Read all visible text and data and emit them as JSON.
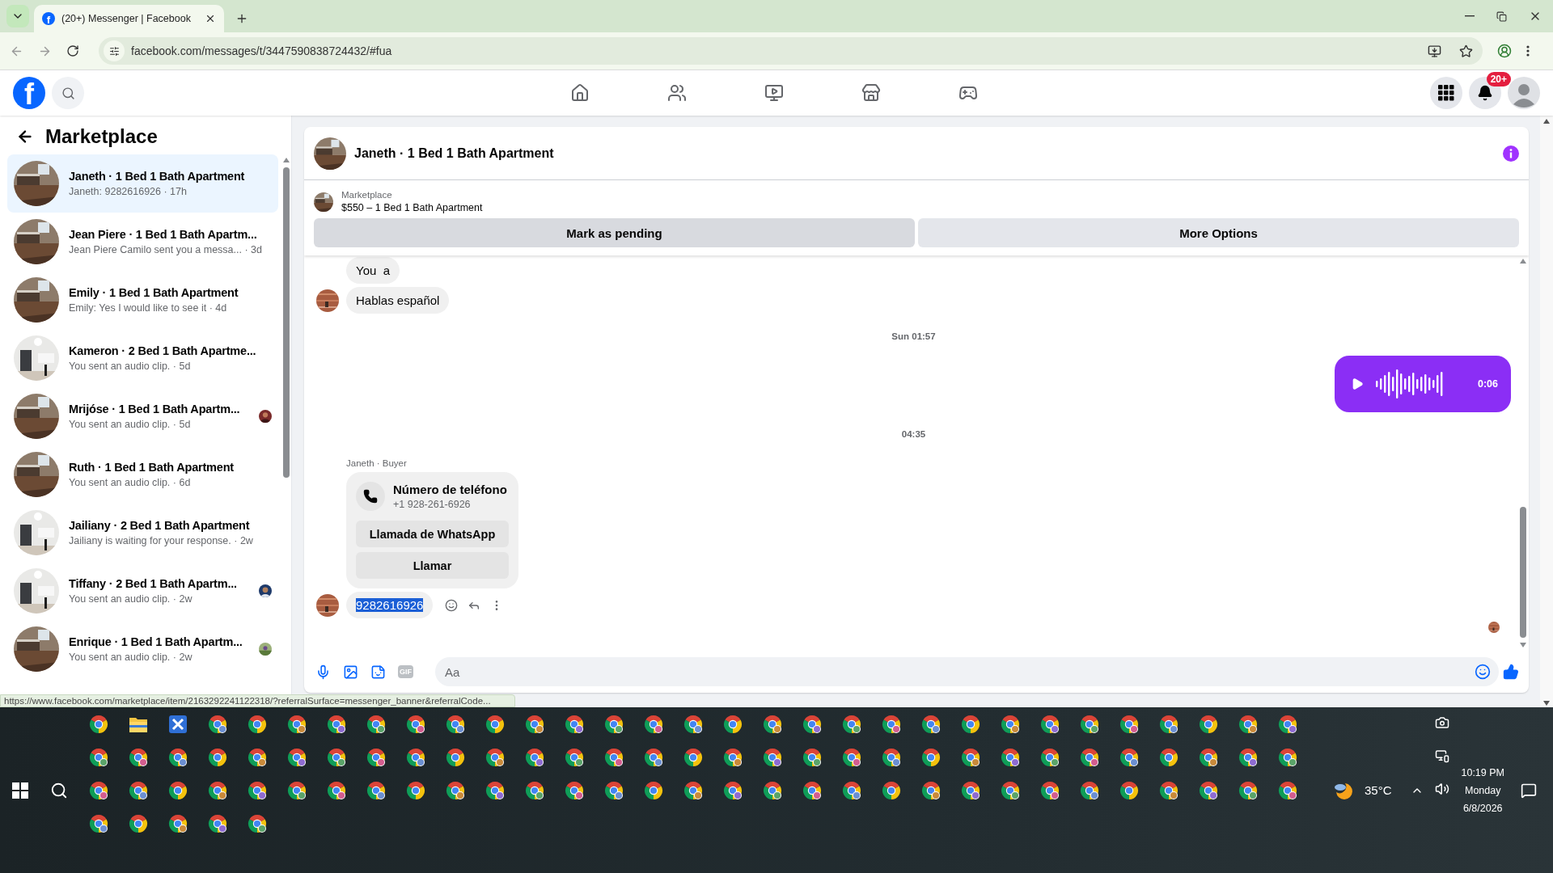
{
  "browser": {
    "favicon_letter": "f",
    "tab_title": "(20+) Messenger | Facebook",
    "url": "facebook.com/messages/t/3447590838724432/#fua",
    "status_url": "https://www.facebook.com/marketplace/item/2163292241122318/?referralSurface=messenger_banner&referralCode..."
  },
  "header": {
    "logo_letter": "f",
    "notification_badge": "20+"
  },
  "sidebar": {
    "title": "Marketplace",
    "conversations": [
      {
        "title": "Janeth · 1 Bed 1 Bath Apartment",
        "preview": "Janeth: 9282616926 · 17h",
        "selected": true,
        "seen": false
      },
      {
        "title": "Jean Piere · 1 Bed 1 Bath Apartm...",
        "preview": "Jean Piere Camilo sent you a messa... · 3d",
        "selected": false,
        "seen": false
      },
      {
        "title": "Emily · 1 Bed 1 Bath Apartment",
        "preview": "Emily: Yes I would like to see it · 4d",
        "selected": false,
        "seen": false
      },
      {
        "title": "Kameron · 2 Bed 1 Bath Apartme...",
        "preview": "You sent an audio clip. · 5d",
        "selected": false,
        "seen": false
      },
      {
        "title": "Mrijóse · 1 Bed 1 Bath Apartm...",
        "preview": "You sent an audio clip. · 5d",
        "selected": false,
        "seen": true
      },
      {
        "title": "Ruth · 1 Bed 1 Bath Apartment",
        "preview": "You sent an audio clip. · 6d",
        "selected": false,
        "seen": false
      },
      {
        "title": "Jailiany · 2 Bed 1 Bath Apartment",
        "preview": "Jailiany is waiting for your response. · 2w",
        "selected": false,
        "seen": false
      },
      {
        "title": "Tiffany · 2 Bed 1 Bath Apartm...",
        "preview": "You sent an audio clip. · 2w",
        "selected": false,
        "seen": true
      },
      {
        "title": "Enrique · 1 Bed 1 Bath Apartm...",
        "preview": "You sent an audio clip. · 2w",
        "selected": false,
        "seen": true
      }
    ]
  },
  "chat": {
    "title": "Janeth · 1 Bed 1 Bath Apartment",
    "listing_source": "Marketplace",
    "listing": "$550 – 1 Bed 1 Bath Apartment",
    "actions": [
      "Mark as pending",
      "More Options"
    ],
    "messages": [
      {
        "kind": "incoming",
        "text": "You  a",
        "avatar": false,
        "highlighted": false,
        "hovered": false
      },
      {
        "kind": "incoming",
        "text": "Hablas español",
        "avatar": true,
        "highlighted": false,
        "hovered": false
      },
      {
        "kind": "timestamp",
        "text": "Sun 01:57"
      },
      {
        "kind": "audio",
        "duration": "0:06"
      },
      {
        "kind": "timestamp",
        "text": "04:35"
      },
      {
        "kind": "contact",
        "sender": "Janeth · Buyer",
        "title": "Número de teléfono",
        "phone": "+1 928-261-6926",
        "buttons": [
          "Llamada de WhatsApp",
          "Llamar"
        ]
      },
      {
        "kind": "incoming",
        "text": "9282616926",
        "avatar": true,
        "highlighted": true,
        "hovered": true
      }
    ],
    "seen": true,
    "composer": {
      "gif_label": "GIF",
      "placeholder": "Aa"
    }
  },
  "taskbar": {
    "weather": "35°C",
    "time": "10:19 PM",
    "day": "Monday",
    "date": "6/8/2026"
  }
}
